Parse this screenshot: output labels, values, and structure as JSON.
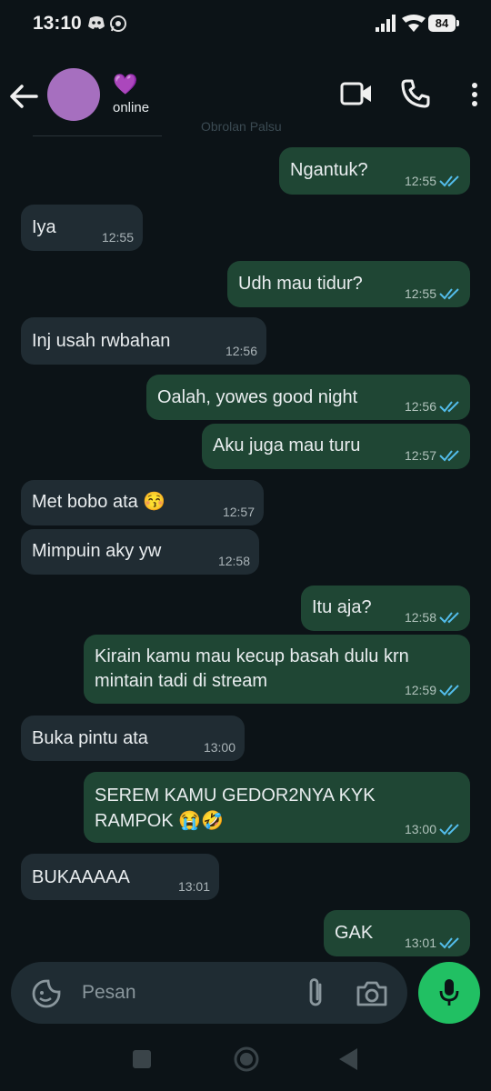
{
  "status_bar": {
    "time": "13:10",
    "battery": "84"
  },
  "header": {
    "contact_emoji": "💜",
    "contact_status": "online",
    "caption": "Obrolan Palsu"
  },
  "messages": [
    {
      "dir": "out",
      "text": "Ngantuk?",
      "time": "12:55"
    },
    {
      "dir": "in",
      "text": "Iya",
      "time": "12:55"
    },
    {
      "dir": "out",
      "text": "Udh mau tidur?",
      "time": "12:55"
    },
    {
      "dir": "in",
      "text": "Inj usah rwbahan",
      "time": "12:56"
    },
    {
      "dir": "out",
      "text": "Oalah, yowes good night",
      "time": "12:56"
    },
    {
      "dir": "out",
      "text": "Aku juga mau turu",
      "time": "12:57"
    },
    {
      "dir": "in",
      "text": "Met bobo ata 😚",
      "time": "12:57"
    },
    {
      "dir": "in",
      "text": "Mimpuin aky yw",
      "time": "12:58"
    },
    {
      "dir": "out",
      "text": "Itu aja?",
      "time": "12:58"
    },
    {
      "dir": "out",
      "text": "Kirain kamu mau kecup basah dulu krn mintain tadi di stream",
      "line1": "Kirain kamu mau kecup basah dulu krn",
      "line2": "mintain tadi di stream",
      "time": "12:59"
    },
    {
      "dir": "in",
      "text": "Buka pintu ata",
      "time": "13:00"
    },
    {
      "dir": "out",
      "text": "SEREM KAMU GEDOR2NYA KYK RAMPOK 😭🤣",
      "line1": "SEREM KAMU GEDOR2NYA KYK",
      "line2": "RAMPOK 😭🤣",
      "time": "13:00"
    },
    {
      "dir": "in",
      "text": "BUKAAAAA",
      "time": "13:01"
    },
    {
      "dir": "out",
      "text": "GAK",
      "time": "13:01"
    }
  ],
  "composer": {
    "placeholder": "Pesan"
  },
  "icons": {
    "back": "arrow-left-icon",
    "video": "video-call-icon",
    "call": "phone-icon",
    "menu": "more-vert-icon",
    "sticker": "sticker-icon",
    "attach": "paperclip-icon",
    "camera": "camera-icon",
    "mic": "mic-icon",
    "read": "double-check-icon"
  },
  "colors": {
    "background": "#0c1317",
    "bubble_out": "#1f4634",
    "bubble_in": "#202c33",
    "read_tick": "#53bdeb",
    "mic": "#21c063",
    "avatar": "#a66fbf"
  }
}
